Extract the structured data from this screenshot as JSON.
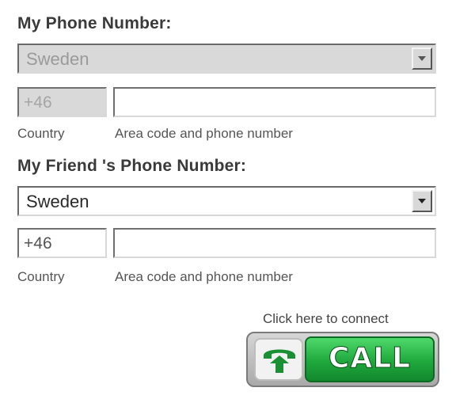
{
  "my_phone": {
    "title": "My Phone Number:",
    "country_select": {
      "value": "Sweden",
      "disabled": true
    },
    "country_code": "+46",
    "phone_value": "",
    "hint_country": "Country",
    "hint_area": "Area code and phone number"
  },
  "friend_phone": {
    "title": "My Friend 's Phone Number:",
    "country_select": {
      "value": "Sweden",
      "disabled": false
    },
    "country_code": "+46",
    "phone_value": "",
    "hint_country": "Country",
    "hint_area": "Area code and phone number"
  },
  "connect": {
    "hint": "Click here to connect",
    "button_label": "CALL",
    "icon": "phone-icon",
    "accent_color": "#1fa83d"
  }
}
